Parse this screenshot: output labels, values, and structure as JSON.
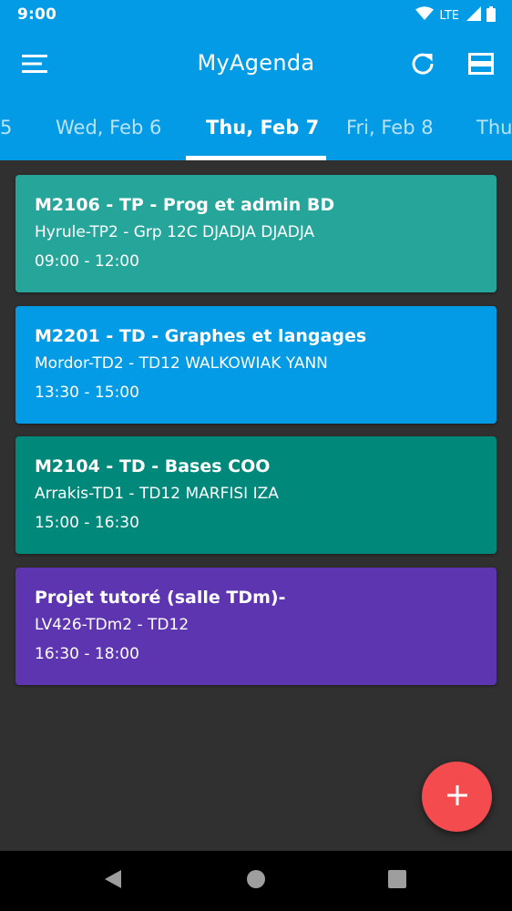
{
  "status_bar": {
    "time": "9:00",
    "network": "LTE",
    "icons": [
      "wifi-icon",
      "signal-icon",
      "battery-icon"
    ]
  },
  "app_bar": {
    "title": "MyAgenda",
    "icons": [
      "menu-icon",
      "refresh-icon",
      "view-agenda-icon"
    ]
  },
  "tabs": [
    {
      "label": "5"
    },
    {
      "label": "Wed, Feb 6"
    },
    {
      "label": "Thu, Feb 7",
      "active": true
    },
    {
      "label": "Fri, Feb 8"
    },
    {
      "label": "Thu"
    }
  ],
  "events": [
    {
      "title": "M2106 - TP - Prog et admin BD",
      "subtitle": "Hyrule-TP2 - Grp 12C DJADJA DJADJA",
      "time": "09:00 - 12:00",
      "color": "#26a69a"
    },
    {
      "title": "M2201 - TD - Graphes et langages",
      "subtitle": "Mordor-TD2 - TD12 WALKOWIAK YANN",
      "time": "13:30 - 15:00",
      "color": "#039be5"
    },
    {
      "title": "M2104 - TD - Bases COO",
      "subtitle": "Arrakis-TD1 - TD12 MARFISI IZA",
      "time": "15:00 - 16:30",
      "color": "#00897b"
    },
    {
      "title": "Projet tutoré (salle TDm)-",
      "subtitle": "LV426-TDm2 - TD12",
      "time": "16:30 - 18:00",
      "color": "#5e35b1"
    }
  ],
  "fab": {
    "icon": "add-icon",
    "color": "#f44b4f"
  },
  "nav_bar": {
    "icons": [
      "back-icon",
      "home-icon",
      "recents-icon"
    ]
  },
  "colors": {
    "primary": "#039be5",
    "background": "#303030"
  }
}
